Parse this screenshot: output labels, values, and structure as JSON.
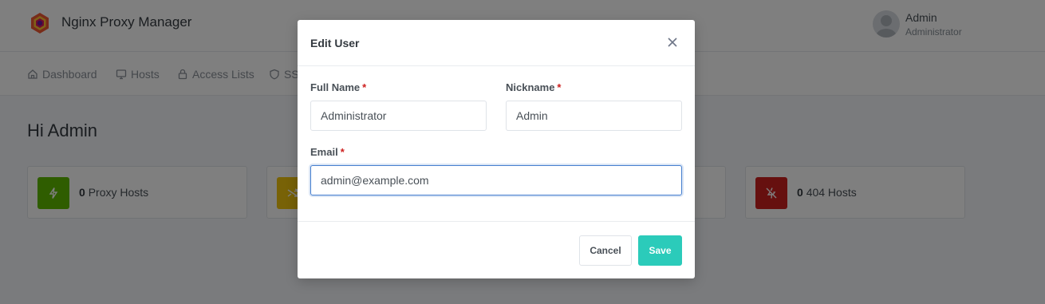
{
  "header": {
    "app_title": "Nginx Proxy Manager",
    "user_name": "Admin",
    "user_role": "Administrator"
  },
  "nav": {
    "items": [
      {
        "label": "Dashboard",
        "icon": "home-icon"
      },
      {
        "label": "Hosts",
        "icon": "monitor-icon"
      },
      {
        "label": "Access Lists",
        "icon": "lock-icon"
      },
      {
        "label": "SSL",
        "icon": "shield-icon"
      }
    ]
  },
  "main": {
    "greeting": "Hi Admin",
    "cards": [
      {
        "count": "0",
        "label": "Proxy Hosts",
        "color": "#5eba00",
        "icon": "bolt-icon"
      },
      {
        "count": "",
        "label": "",
        "color": "#f1c40f",
        "icon": "shuffle-icon"
      },
      {
        "count": "0",
        "label": "404 Hosts",
        "color": "#cd201f",
        "icon": "zap-off-icon"
      }
    ]
  },
  "modal": {
    "title": "Edit User",
    "full_name_label": "Full Name",
    "full_name_value": "Administrator",
    "nickname_label": "Nickname",
    "nickname_value": "Admin",
    "email_label": "Email",
    "email_value": "admin@example.com",
    "required_marker": "*",
    "cancel_label": "Cancel",
    "save_label": "Save"
  },
  "colors": {
    "accent": "#2bcbba",
    "focus": "#467fcf",
    "required": "#cd201f"
  }
}
